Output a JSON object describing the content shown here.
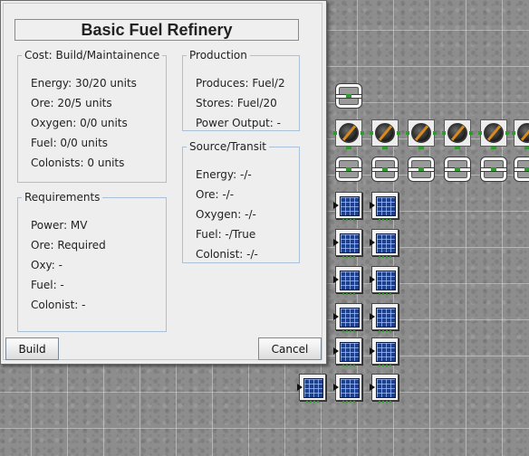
{
  "dialog": {
    "title": "Basic Fuel Refinery",
    "cost": {
      "heading": "Cost: Build/Maintainence",
      "rows": [
        "Energy: 30/20 units",
        "Ore: 20/5 units",
        "Oxygen: 0/0 units",
        "Fuel: 0/0 units",
        "Colonists: 0 units"
      ]
    },
    "requirements": {
      "heading": "Requirements",
      "rows": [
        "Power: MV",
        "Ore: Required",
        "Oxy: -",
        "Fuel: -",
        "Colonist: -"
      ]
    },
    "production": {
      "heading": "Production",
      "rows": [
        "Produces: Fuel/2",
        "Stores: Fuel/20",
        "Power Output: -"
      ]
    },
    "source_transit": {
      "heading": "Source/Transit",
      "rows": [
        "Energy: -/-",
        "Ore: -/-",
        "Oxygen: -/-",
        "Fuel: -/True",
        "Colonist: -/-"
      ]
    },
    "buttons": {
      "build": "Build",
      "cancel": "Cancel"
    }
  },
  "map": {
    "colors": {
      "ground": "#8d8d8d",
      "grid": "#d7d7d7",
      "connector": "#2f9b2f",
      "solar": "#1c3f8f",
      "gauge_needle": "#d98a1c"
    },
    "icons": {
      "pipe": "pipe-connector-icon",
      "refinery": "refinery-gauge-icon",
      "solar": "solar-panel-icon"
    }
  }
}
